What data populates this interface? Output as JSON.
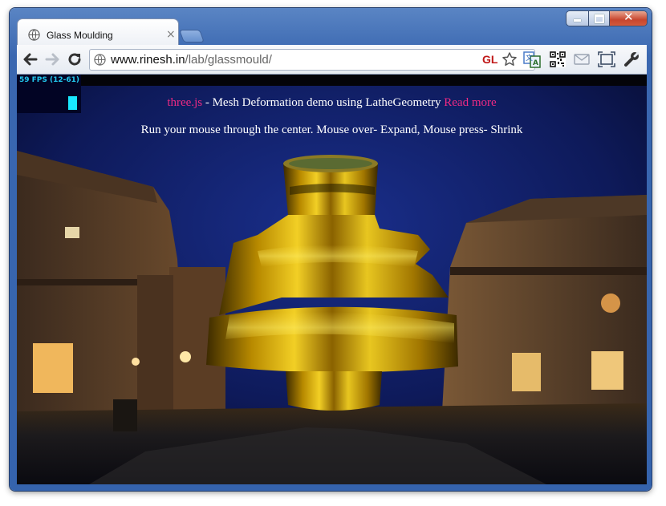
{
  "tab": {
    "title": "Glass Moulding",
    "close": "×"
  },
  "address": {
    "host": "www.rinesh.in",
    "path": "/lab/glassmould/"
  },
  "badge": {
    "gl": "GL"
  },
  "stats": {
    "text": "59 FPS (12-61)"
  },
  "overlay": {
    "link_threejs": "three.js",
    "description": " - Mesh Deformation demo using LatheGeometry ",
    "link_read_more": "Read more",
    "instructions": "Run your mouse through the center. Mouse over- Expand, Mouse press- Shrink"
  },
  "colors": {
    "link": "#ee2a83",
    "stats_text": "#22c8ee",
    "stats_bar": "#19e7ff",
    "frame": "#3563ad",
    "close_button": "#c8462e"
  },
  "icons": {
    "favicon": "globe-icon",
    "back": "arrow-left-icon",
    "forward": "arrow-right-icon",
    "reload": "reload-icon",
    "bookmark": "star-icon",
    "translate": "translate-icon",
    "qr": "qr-code-icon",
    "mail": "mail-icon",
    "fullscreen": "fullscreen-icon",
    "settings": "wrench-icon"
  }
}
